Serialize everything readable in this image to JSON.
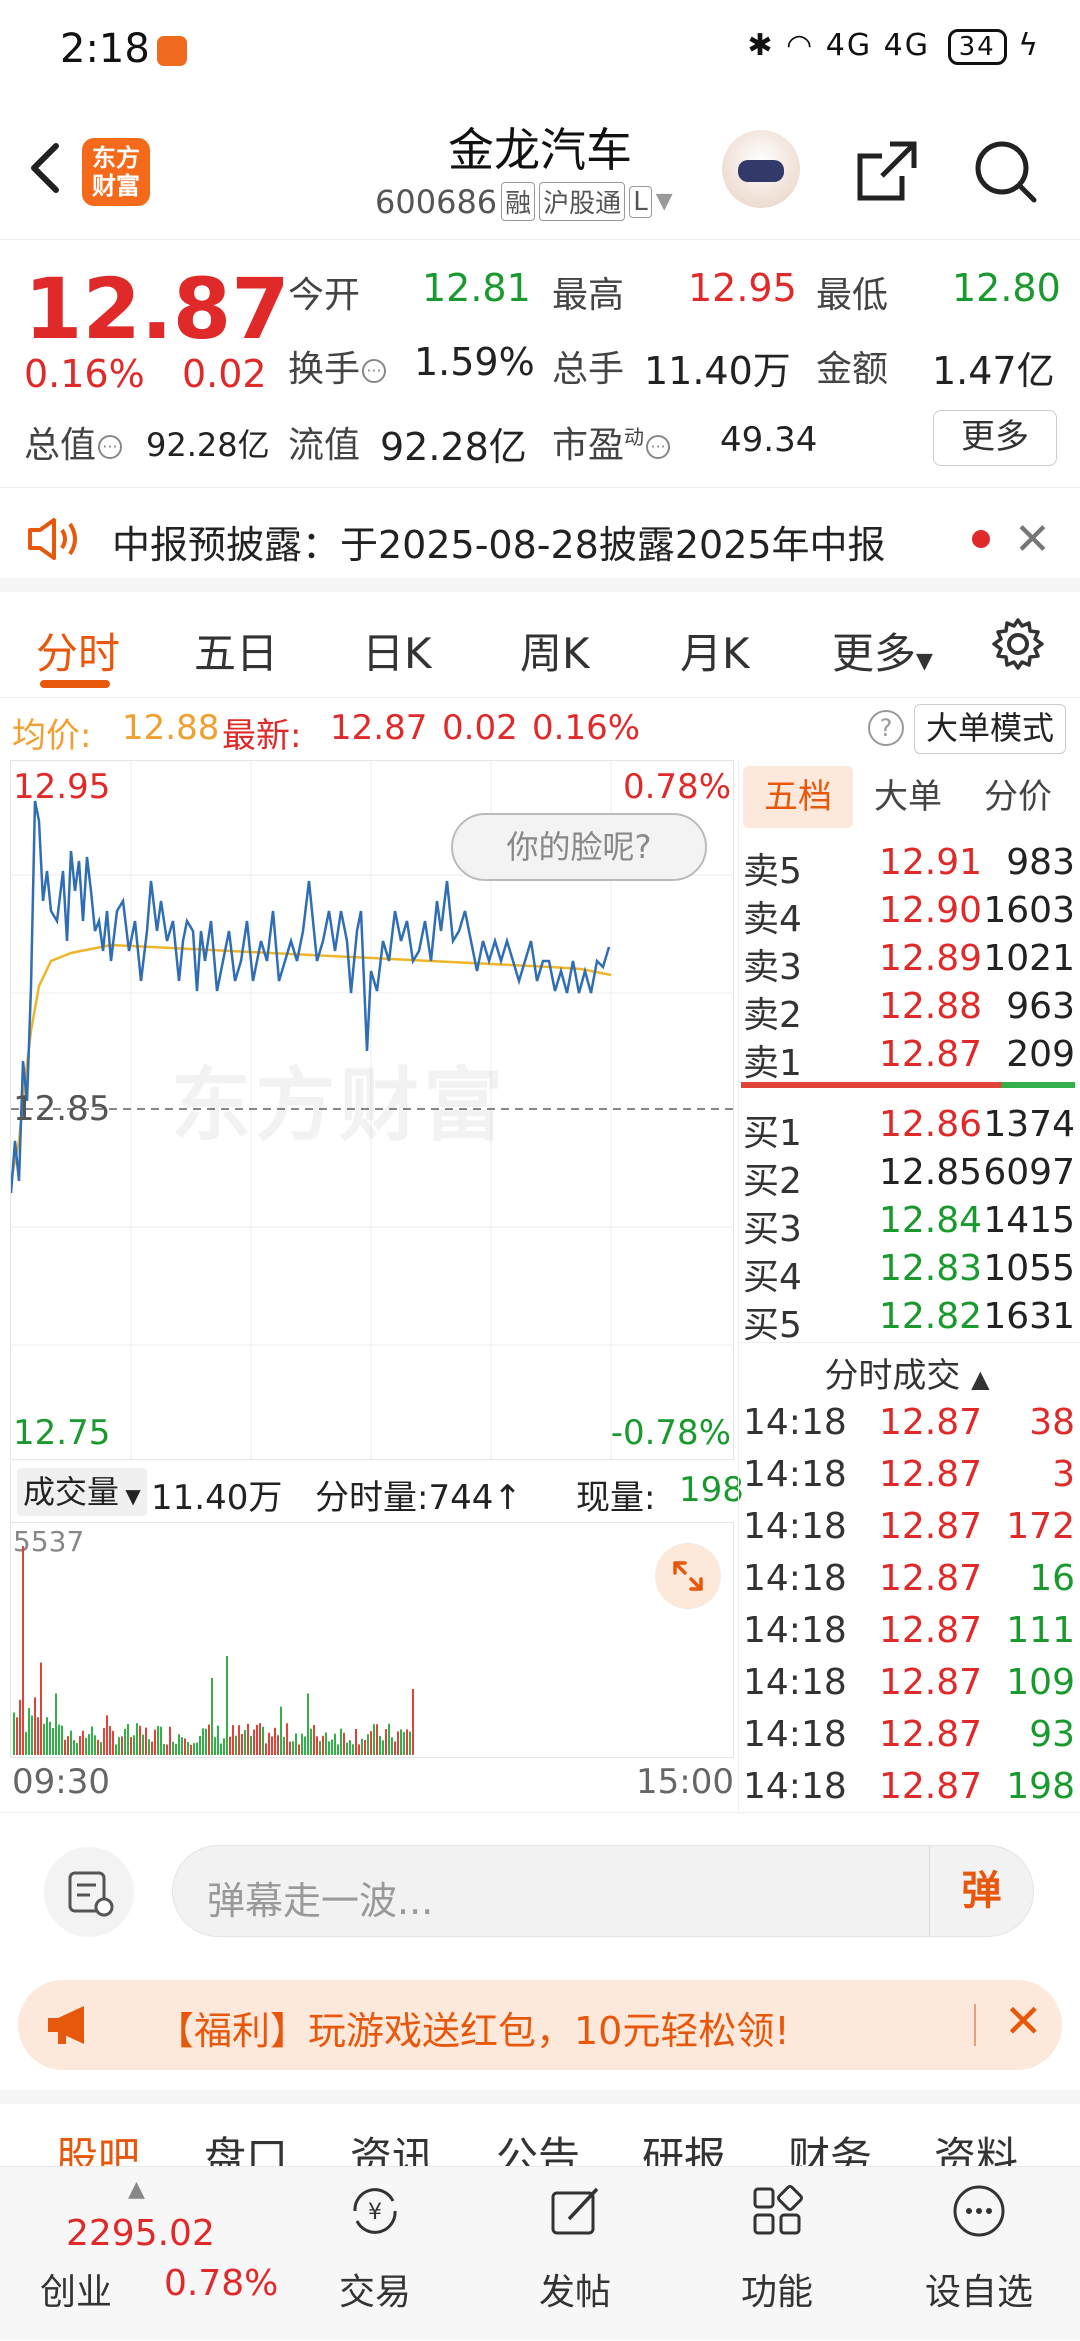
{
  "status_bar": {
    "time": "2:18",
    "network": "4G 4G",
    "battery": "34"
  },
  "header": {
    "title": "金龙汽车",
    "code": "600686",
    "tags": [
      "融",
      "沪股通",
      "L"
    ],
    "logo_text": "东方财富"
  },
  "quote": {
    "price": "12.87",
    "change_pct": "0.16%",
    "change_abs": "0.02",
    "open_label": "今开",
    "open": "12.81",
    "high_label": "最高",
    "high": "12.95",
    "low_label": "最低",
    "low": "12.80",
    "turnover_label": "换手",
    "turnover": "1.59%",
    "volume_label": "总手",
    "volume": "11.40万",
    "amount_label": "金额",
    "amount": "1.47亿",
    "mktcap_label": "总值",
    "mktcap": "92.28亿",
    "float_label": "流值",
    "float": "92.28亿",
    "pe_label": "市盈",
    "pe_sup": "动",
    "pe": "49.34",
    "more_button": "更多"
  },
  "notice": {
    "text": "中报预披露：于2025-08-28披露2025年中报"
  },
  "chart_tabs": [
    "分时",
    "五日",
    "日K",
    "周K",
    "月K",
    "更多"
  ],
  "info_row": {
    "avg_label": "均价:",
    "avg": "12.88",
    "latest_label": "最新:",
    "latest": "12.87",
    "chg": "0.02",
    "pct": "0.16%",
    "big_order_mode": "大单模式"
  },
  "chart": {
    "y_max": "12.95",
    "y_min": "12.75",
    "y_mid": "12.85",
    "pct_max": "0.78%",
    "pct_min": "-0.78%",
    "tooltip": "你的脸呢?",
    "watermark": "东方财富"
  },
  "volume_bar": {
    "selector": "成交量",
    "total": "11.40万",
    "minute_label": "分时量:744",
    "now_label": "现量:",
    "now": "198",
    "max_label": "5537",
    "time_start": "09:30",
    "time_end": "15:00"
  },
  "order_book": {
    "tabs": [
      "五档",
      "大单",
      "分价"
    ],
    "asks": [
      {
        "label": "卖5",
        "price": "12.91",
        "vol": "983"
      },
      {
        "label": "卖4",
        "price": "12.90",
        "vol": "1603"
      },
      {
        "label": "卖3",
        "price": "12.89",
        "vol": "1021"
      },
      {
        "label": "卖2",
        "price": "12.88",
        "vol": "963"
      },
      {
        "label": "卖1",
        "price": "12.87",
        "vol": "209"
      }
    ],
    "bids": [
      {
        "label": "买1",
        "price": "12.86",
        "vol": "1374"
      },
      {
        "label": "买2",
        "price": "12.85",
        "vol": "6097"
      },
      {
        "label": "买3",
        "price": "12.84",
        "vol": "1415"
      },
      {
        "label": "买4",
        "price": "12.83",
        "vol": "1055"
      },
      {
        "label": "买5",
        "price": "12.82",
        "vol": "1631"
      }
    ],
    "ticks_title": "分时成交",
    "ticks": [
      {
        "t": "14:18",
        "p": "12.87",
        "v": "38",
        "c": "red"
      },
      {
        "t": "14:18",
        "p": "12.87",
        "v": "3",
        "c": "red"
      },
      {
        "t": "14:18",
        "p": "12.87",
        "v": "172",
        "c": "red"
      },
      {
        "t": "14:18",
        "p": "12.87",
        "v": "16",
        "c": "green"
      },
      {
        "t": "14:18",
        "p": "12.87",
        "v": "111",
        "c": "green"
      },
      {
        "t": "14:18",
        "p": "12.87",
        "v": "109",
        "c": "green"
      },
      {
        "t": "14:18",
        "p": "12.87",
        "v": "93",
        "c": "green"
      },
      {
        "t": "14:18",
        "p": "12.87",
        "v": "198",
        "c": "green"
      }
    ]
  },
  "comment_bar": {
    "placeholder": "弹幕走一波...",
    "send": "弹"
  },
  "promo": {
    "text": "【福利】玩游戏送红包，10元轻松领!"
  },
  "sub_tabs": [
    "股吧",
    "盘口",
    "资讯",
    "公告",
    "研报",
    "财务",
    "资料"
  ],
  "bottom_nav": {
    "index_value": "2295.02",
    "index_name": "创业",
    "index_pct": "0.78%",
    "items": [
      "交易",
      "发帖",
      "功能",
      "设自选"
    ]
  },
  "colors": {
    "accent": "#e8580c",
    "up": "#e02a2a",
    "down": "#1a9a2e",
    "price_line": "#2f6db5",
    "avg_line": "#f0b429"
  }
}
